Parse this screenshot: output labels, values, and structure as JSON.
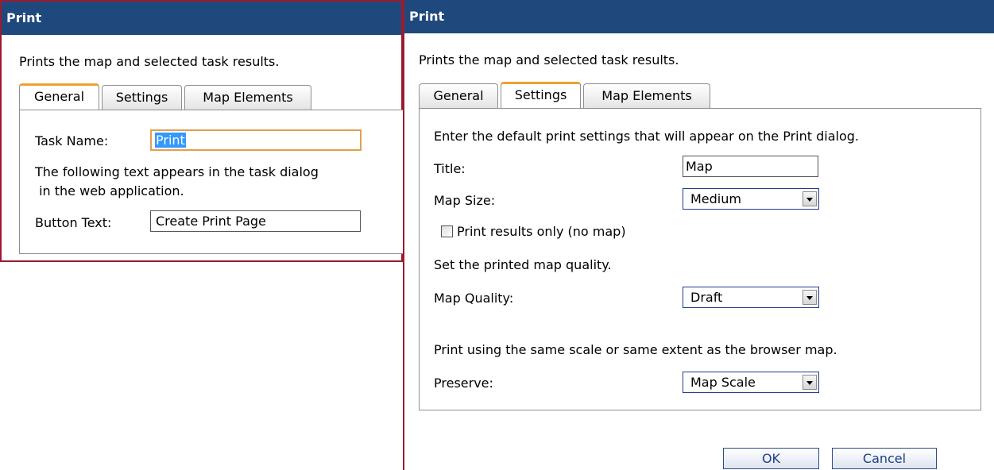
{
  "left_dialog": {
    "title": "Print",
    "description": "Prints the map and selected task results.",
    "tabs": [
      {
        "label": "General",
        "active": true
      },
      {
        "label": "Settings",
        "active": false
      },
      {
        "label": "Map Elements",
        "active": false
      }
    ],
    "general": {
      "task_name_label": "Task Name:",
      "task_name_value": "Print",
      "info_line1": "The following text appears in the task dialog",
      "info_line2": " in the web application.",
      "button_text_label": "Button Text:",
      "button_text_value": "Create Print Page"
    }
  },
  "right_dialog": {
    "title": "Print",
    "description": "Prints the map and selected task results.",
    "tabs": [
      {
        "label": "General",
        "active": false
      },
      {
        "label": "Settings",
        "active": true
      },
      {
        "label": "Map Elements",
        "active": false
      }
    ],
    "settings": {
      "intro": "Enter the default print settings that will appear on the Print dialog.",
      "title_label": "Title:",
      "title_value": "Map",
      "map_size_label": "Map Size:",
      "map_size_value": "Medium",
      "results_only_label": "Print results only (no map)",
      "results_only_checked": false,
      "quality_intro": "Set the printed map quality.",
      "map_quality_label": "Map Quality:",
      "map_quality_value": "Draft",
      "preserve_intro": "Print using the same scale or same extent as the browser map.",
      "preserve_label": "Preserve:",
      "preserve_value": "Map Scale"
    },
    "buttons": {
      "ok": "OK",
      "cancel": "Cancel"
    }
  },
  "colors": {
    "titlebar": "#1f497d",
    "panel_border": "#9b1b30",
    "active_tab_accent": "#f0a030",
    "text_selection": "#3399ff",
    "button_text": "#1f3f86"
  }
}
